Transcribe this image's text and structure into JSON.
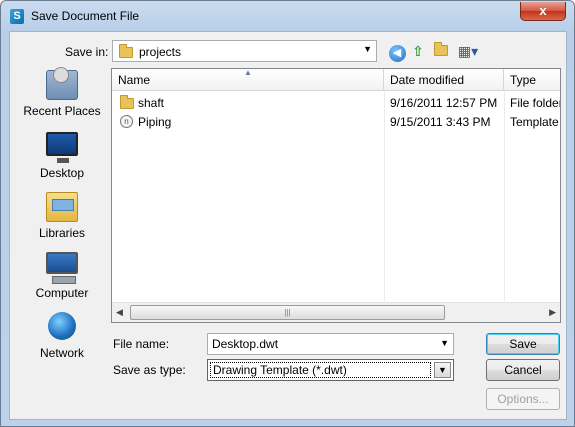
{
  "window": {
    "title": "Save Document File",
    "close_label": "x"
  },
  "toolbar": {
    "save_in_label": "Save in:",
    "save_in_value": "projects",
    "icons": [
      "back-icon",
      "up-folder-icon",
      "new-folder-icon",
      "view-menu-icon"
    ]
  },
  "places": [
    {
      "label": "Recent Places",
      "icon": "recent-places-icon"
    },
    {
      "label": "Desktop",
      "icon": "desktop-icon"
    },
    {
      "label": "Libraries",
      "icon": "libraries-icon"
    },
    {
      "label": "Computer",
      "icon": "computer-icon"
    },
    {
      "label": "Network",
      "icon": "network-icon"
    }
  ],
  "file_list": {
    "columns": [
      "Name",
      "Date modified",
      "Type"
    ],
    "rows": [
      {
        "name": "shaft",
        "date": "9/16/2011 12:57 PM",
        "type": "File folder",
        "icon": "folder-icon"
      },
      {
        "name": "Piping",
        "date": "9/15/2011 3:43 PM",
        "type": "Template",
        "icon": "template-icon"
      }
    ]
  },
  "form": {
    "file_name_label": "File name:",
    "file_name_value": "Desktop.dwt",
    "save_type_label": "Save as type:",
    "save_type_value": "Drawing Template (*.dwt)"
  },
  "buttons": {
    "save": "Save",
    "cancel": "Cancel",
    "options": "Options..."
  },
  "colors": {
    "title_bar": "#c9dbef",
    "close_button": "#c3331a",
    "dialog_background": "#f0f0f0"
  }
}
